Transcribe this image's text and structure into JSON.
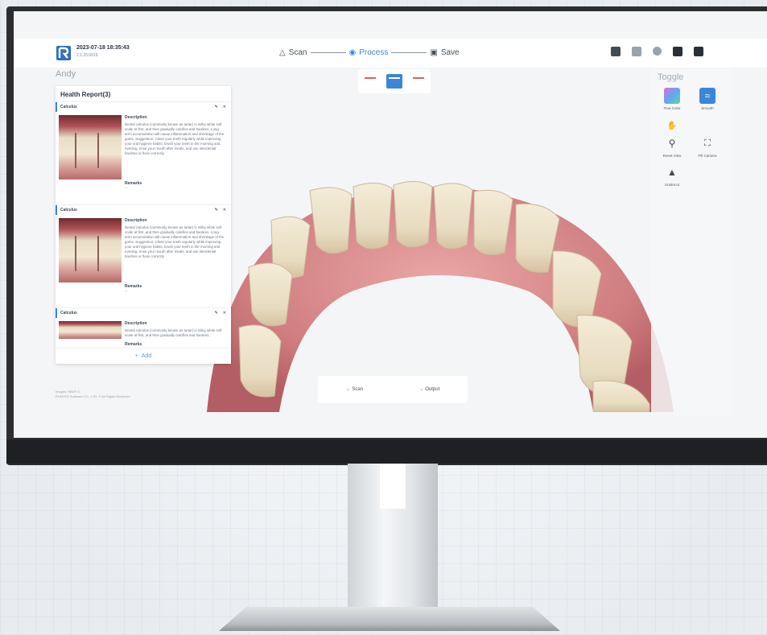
{
  "header": {
    "timestamp": "2023-07-18 18:35:43",
    "subtitle": "2.1.23.0019",
    "steps": [
      {
        "label": "Scan",
        "icon": "scanner-icon",
        "active": false
      },
      {
        "label": "Process",
        "icon": "process-icon",
        "active": true
      },
      {
        "label": "Save",
        "icon": "save-icon",
        "active": false
      }
    ]
  },
  "patient": {
    "name": "Andy"
  },
  "toolbar": {
    "title": "Toggle",
    "tools": [
      {
        "label": "True Color",
        "icon": "true-color-icon"
      },
      {
        "label": "Smooth",
        "icon": "smooth-icon"
      },
      {
        "label": "Reset View",
        "icon": "reset-view-icon"
      },
      {
        "label": "Fill Camera",
        "icon": "fill-camera-icon"
      },
      {
        "label": "Undercut",
        "icon": "undercut-icon"
      }
    ]
  },
  "report": {
    "title": "Health Report(3)",
    "entries": [
      {
        "tag": "Calculus",
        "desc_label": "Description",
        "description": "Dental calculus (commonly known as tartar) is milky white soft scale at first, and then gradually calcifies and hardens. Long-term accumulation will cause inflammation and shrinkage of the gums. Suggestion: Clean your teeth regularly while improving your oral hygiene habits; brush your teeth in the morning and evening, rinse your mouth after meals, and use interdental brushes or floss correctly.",
        "remark_label": "Remarks",
        "remark": "--"
      },
      {
        "tag": "Calculus",
        "desc_label": "Description",
        "description": "Dental calculus (commonly known as tartar) is milky white soft scale at first, and then gradually calcifies and hardens. Long-term accumulation will cause inflammation and shrinkage of the gums. Suggestion: Clean your teeth regularly while improving your oral hygiene habits; brush your teeth in the morning and evening, rinse your mouth after meals, and use interdental brushes or floss correctly.",
        "remark_label": "Remarks",
        "remark": "--"
      },
      {
        "tag": "Calculus",
        "desc_label": "Description",
        "description": "Dental calculus (commonly known as tartar) is milky white soft scale at first, and then gradually calcifies and hardens.",
        "remark_label": "Remarks",
        "remark": "--"
      }
    ],
    "add_label": "Add"
  },
  "bottom_nav": {
    "back_label": "Scan",
    "next_label": "Output"
  },
  "footer": {
    "line1": "Images: RBDF-0",
    "line2": "RUNYES Software CO., LTD. © All Rights Reserved"
  },
  "colors": {
    "accent": "#3b86d9",
    "gum": "#d98a8c",
    "tooth": "#efe6cf"
  }
}
